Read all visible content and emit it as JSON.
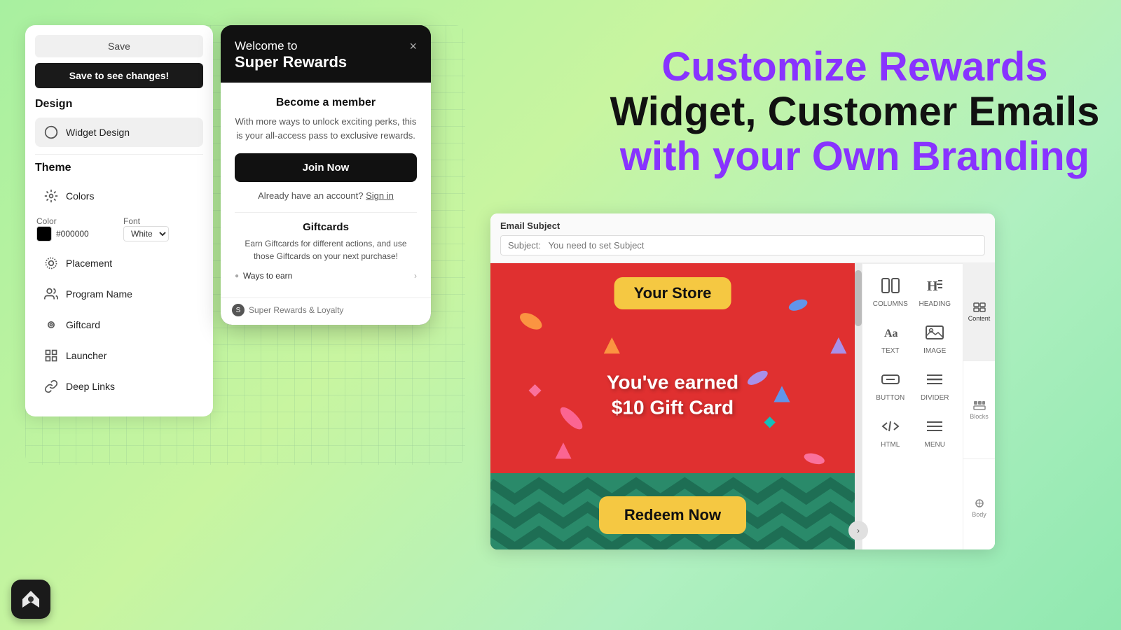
{
  "leftPanel": {
    "saveButton": "Save",
    "saveToSeeButton": "Save to see changes!",
    "designSection": "Design",
    "widgetDesign": "Widget Design",
    "themeSection": "Theme",
    "colors": "Colors",
    "colorLabel": "Color",
    "fontLabel": "Font",
    "colorHex": "#000000",
    "fontValue": "White",
    "placementLabel": "Placement",
    "programNameLabel": "Program Name",
    "giftcardLabel": "Giftcard",
    "launcherLabel": "Launcher",
    "deepLinksLabel": "Deep Links"
  },
  "widgetPopup": {
    "welcomeTo": "Welcome to",
    "superRewards": "Super Rewards",
    "closeBtn": "×",
    "becomeMember": "Become a member",
    "memberDesc": "With more ways to unlock exciting perks, this is your all-access pass to exclusive rewards.",
    "joinNowBtn": "Join Now",
    "alreadyAccount": "Already have an account?",
    "signIn": "Sign in",
    "giftcardsTitle": "Giftcards",
    "giftcardsDesc": "Earn Giftcards for different actions, and use those Giftcards on your next purchase!",
    "waysToEarn": "Ways to earn",
    "footerText": "Super Rewards & Loyalty"
  },
  "heroText": {
    "customize": "Customize",
    "rewards": " Rewards",
    "line2": "Widget, Customer Emails",
    "withYourOwn": "with your Own ",
    "branding": "Branding"
  },
  "emailEditor": {
    "subjectLabel": "Email Subject",
    "subjectPlaceholder": "Subject:   You need to set Subject",
    "storeName": "Your Store",
    "earnedLine1": "You've earned",
    "earnedLine2": "$10 Gift Card",
    "redeemBtn": "Redeem Now"
  },
  "toolbar": {
    "contentTab": "Content",
    "blocksTab": "Blocks",
    "bodyTab": "Body",
    "columnsLabel": "COLUMNS",
    "headingLabel": "HEADING",
    "textLabel": "TEXT",
    "imageLabel": "IMAGE",
    "buttonLabel": "BUTTON",
    "dividerLabel": "DIVIDER",
    "htmlLabel": "HTML",
    "menuLabel": "MENU"
  },
  "colors": {
    "purple": "#8833ff",
    "black": "#111111",
    "green": "#7ed957",
    "red": "#e03030",
    "gold": "#f5c842",
    "teal": "#2a8a6a"
  }
}
